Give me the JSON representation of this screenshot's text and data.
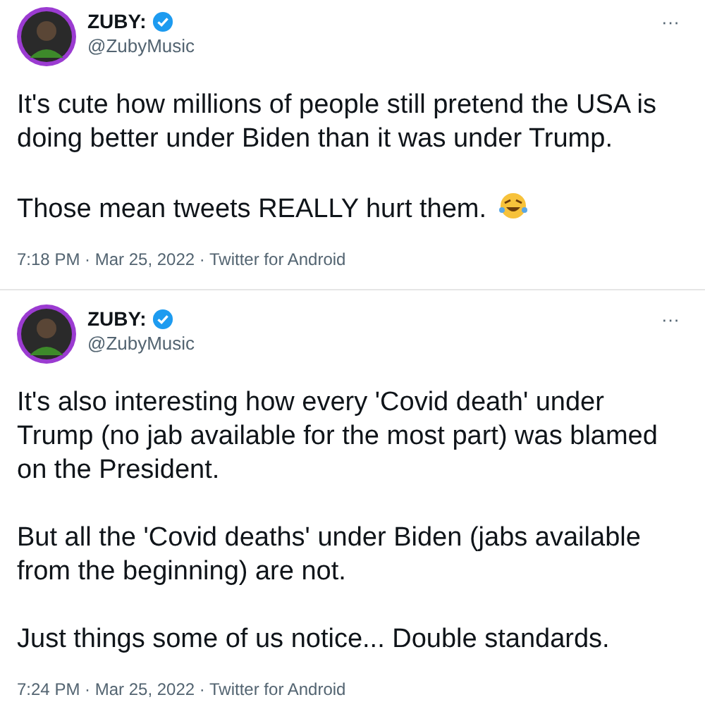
{
  "tweets": [
    {
      "name": "ZUBY:",
      "verified": true,
      "handle": "@ZubyMusic",
      "more": "···",
      "paragraphs": [
        "It's cute how millions of people still pretend the USA is doing better under Biden than it was under Trump.",
        "Those mean tweets REALLY hurt them."
      ],
      "emoji_after_last": true,
      "meta": "7:18 PM · Mar 25, 2022 · Twitter for Android"
    },
    {
      "name": "ZUBY:",
      "verified": true,
      "handle": "@ZubyMusic",
      "more": "···",
      "paragraphs": [
        "It's also interesting how every 'Covid death' under Trump (no jab available for the most part) was blamed on the President.",
        "But all the 'Covid deaths' under Biden (jabs available from the beginning) are not.",
        "Just things some of us notice... Double standards."
      ],
      "emoji_after_last": false,
      "meta": "7:24 PM · Mar 25, 2022 · Twitter for Android"
    }
  ]
}
